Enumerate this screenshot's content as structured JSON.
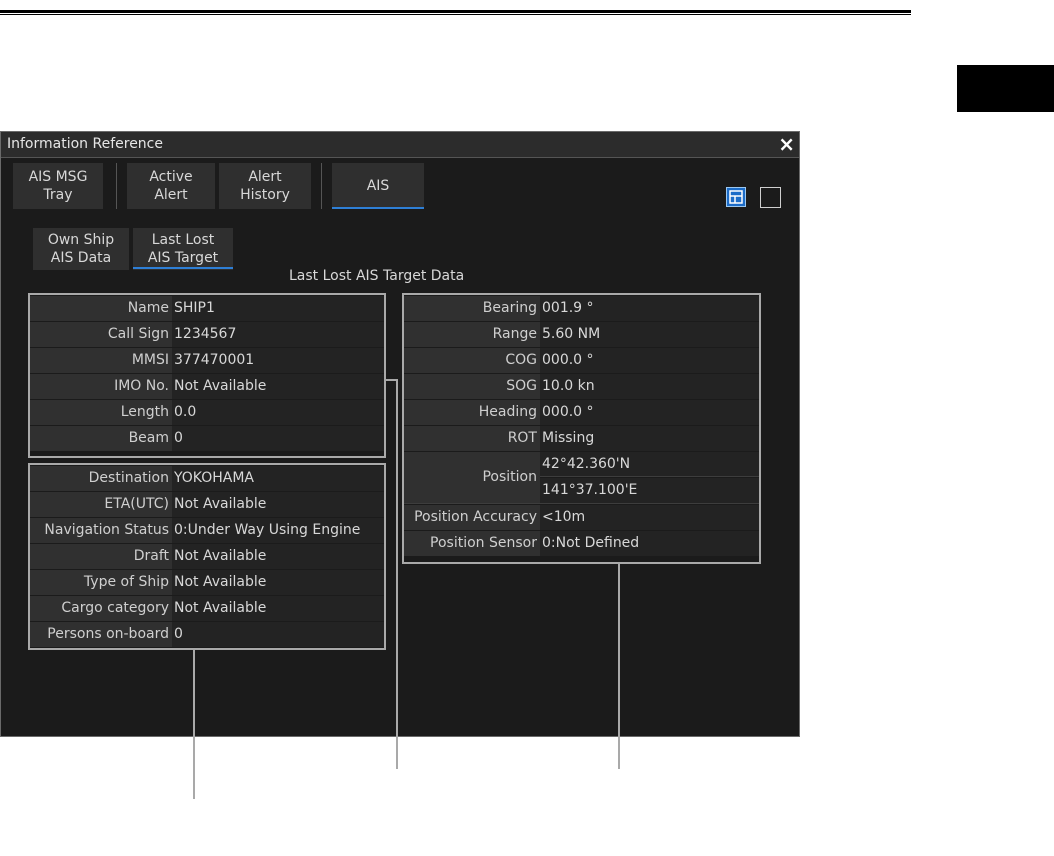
{
  "window": {
    "title": "Information Reference",
    "close_icon": "×"
  },
  "tabs": [
    {
      "label": "AIS MSG\nTray"
    },
    {
      "label": "Active\nAlert"
    },
    {
      "label": "Alert\nHistory"
    },
    {
      "label": "AIS",
      "active": true
    }
  ],
  "subtabs": [
    {
      "label": "Own Ship\nAIS Data"
    },
    {
      "label": "Last Lost\nAIS Target",
      "active": true
    }
  ],
  "section_title": "Last Lost AIS Target Data",
  "ship_info": [
    {
      "label": "Name",
      "value": "SHIP1"
    },
    {
      "label": "Call Sign",
      "value": "1234567"
    },
    {
      "label": "MMSI",
      "value": "377470001"
    },
    {
      "label": "IMO No.",
      "value": "Not Available"
    },
    {
      "label": "Length",
      "value": "0.0"
    },
    {
      "label": "Beam",
      "value": "0"
    }
  ],
  "voyage_info": [
    {
      "label": "Destination",
      "value": "YOKOHAMA"
    },
    {
      "label": "ETA(UTC)",
      "value": "Not Available"
    },
    {
      "label": "Navigation Status",
      "value": "0:Under Way Using Engine"
    },
    {
      "label": "Draft",
      "value": "Not Available"
    },
    {
      "label": "Type of Ship",
      "value": "Not Available"
    },
    {
      "label": "Cargo category",
      "value": "Not Available"
    },
    {
      "label": "Persons on-board",
      "value": "0"
    }
  ],
  "nav_info": {
    "bearing": {
      "label": "Bearing",
      "value": "001.9 °"
    },
    "range": {
      "label": "Range",
      "value": "5.60 NM"
    },
    "cog": {
      "label": "COG",
      "value": "000.0 °"
    },
    "sog": {
      "label": "SOG",
      "value": "10.0 kn"
    },
    "heading": {
      "label": "Heading",
      "value": "000.0 °"
    },
    "rot": {
      "label": "ROT",
      "value": "Missing"
    },
    "position": {
      "label": "Position",
      "lat": "42°42.360'N",
      "lon": "141°37.100'E"
    },
    "accuracy": {
      "label": "Position Accuracy",
      "value": "<10m"
    },
    "sensor": {
      "label": "Position Sensor",
      "value": "0:Not Defined"
    }
  }
}
